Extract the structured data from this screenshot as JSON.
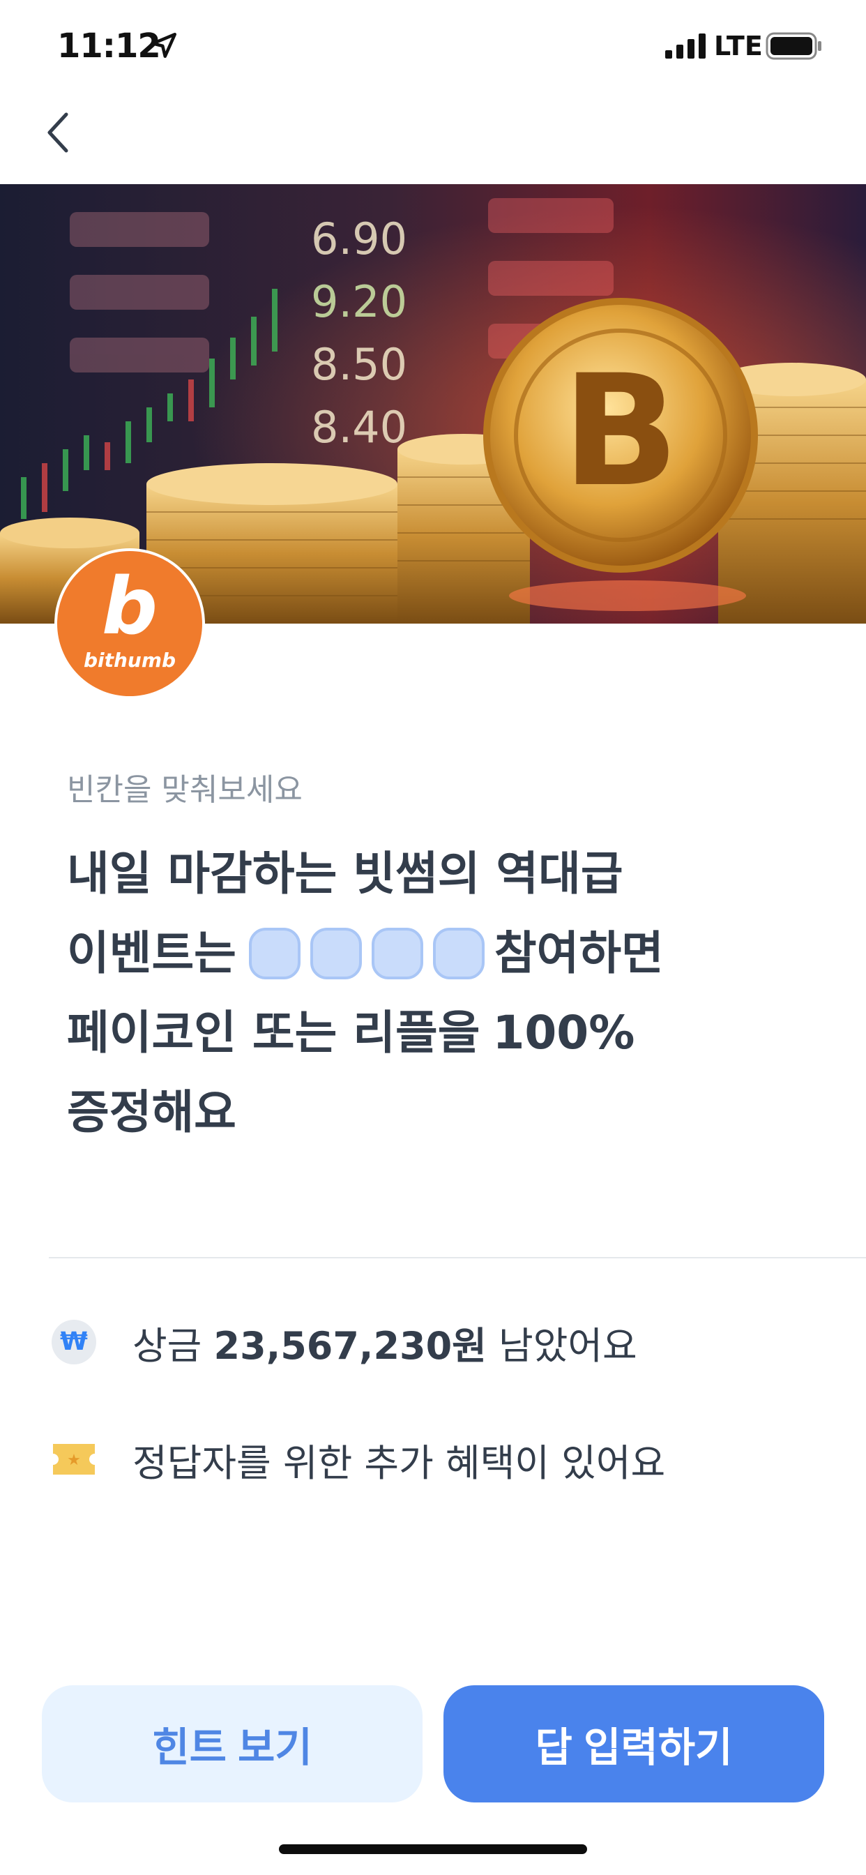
{
  "status_bar": {
    "time": "11:12",
    "network": "LTE",
    "icons": [
      "location-arrow-icon",
      "signal-icon",
      "battery-icon"
    ]
  },
  "nav": {
    "back_icon": "chevron-left-icon"
  },
  "banner": {
    "board_values": [
      "6.90",
      "9.20",
      "8.50",
      "8.40"
    ],
    "logo_letter": "b",
    "logo_text": "bithumb",
    "logo_color": "#f07b2c"
  },
  "quiz": {
    "subtitle": "빈칸을 맞춰보세요",
    "line1": "내일 마감하는 빗썸의 역대급",
    "line2_before": "이벤트는",
    "blank_count": 4,
    "line2_after": "참여하면",
    "line3_normal": "페이코인 또는 리플을",
    "line3_bold": "100%",
    "line4": "증정해요"
  },
  "info": {
    "prize_prefix": "상금",
    "prize_amount": "23,567,230원",
    "prize_suffix": "남았어요",
    "prize_icon": "won-coin-icon",
    "benefit_text": "정답자를 위한 추가 혜택이 있어요",
    "benefit_icon": "ticket-icon"
  },
  "buttons": {
    "hint": "힌트 보기",
    "answer": "답 입력하기"
  },
  "colors": {
    "primary": "#4a83ec",
    "primary_light": "#e8f3ff",
    "blank_fill": "#c9dcfb",
    "text_main": "#333d4b",
    "text_sub": "#8b95a1"
  }
}
